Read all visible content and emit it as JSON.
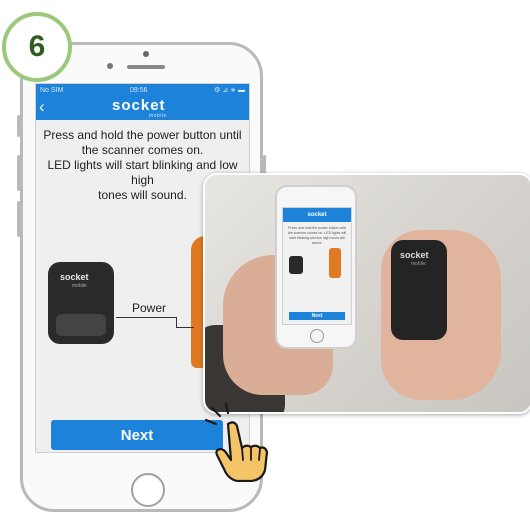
{
  "step": {
    "number": "6"
  },
  "status_bar": {
    "carrier": "No SIM",
    "time": "09:56",
    "right": "⚙ ⊿ ∗ ▬"
  },
  "nav": {
    "logo": "socket",
    "logo_sub": "mobile"
  },
  "instructions": {
    "line1": "Press and hold the power button until",
    "line2": "the scanner comes on.",
    "line3": "LED lights will start blinking and low high",
    "line4": "tones will sound."
  },
  "diagram": {
    "power_label": "Power",
    "scanner_brand": "socket",
    "scanner_brand_sub": "mobile"
  },
  "next_button": {
    "label": "Next"
  },
  "photo": {
    "mini_logo": "socket",
    "mini_text": "Press and hold the power button until the scanner comes on. LED lights will start blinking and low high tones will sound.",
    "mini_next": "Next",
    "big_scanner_brand": "socket",
    "big_scanner_brand_sub": "mobile"
  },
  "colors": {
    "accent": "#1d82d9",
    "step_ring": "#9bc87a",
    "scanner_orange": "#e07a22"
  }
}
